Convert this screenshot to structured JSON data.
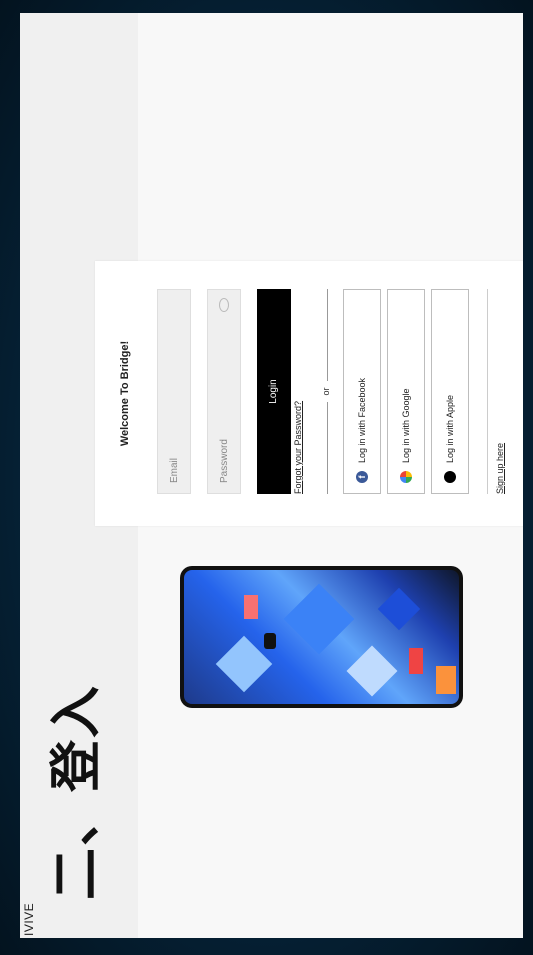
{
  "slide": {
    "brand": "IVIVE",
    "section_title": "二、登入"
  },
  "login": {
    "title": "Welcome To Bridge!",
    "email_placeholder": "Email",
    "password_placeholder": "Password",
    "login_label": "Login",
    "forgot_label": "Forgot your Password?",
    "or_label": "or",
    "facebook_label": "Log in with Facebook",
    "google_label": "Log in with Google",
    "apple_label": "Log in with Apple",
    "signup_label": "Sign up here"
  },
  "icons": {
    "facebook": "facebook-icon",
    "google": "google-icon",
    "apple": "apple-icon",
    "eye": "eye-icon"
  },
  "colors": {
    "background": "#06243a",
    "login_button": "#000000",
    "facebook": "#3b5998"
  }
}
